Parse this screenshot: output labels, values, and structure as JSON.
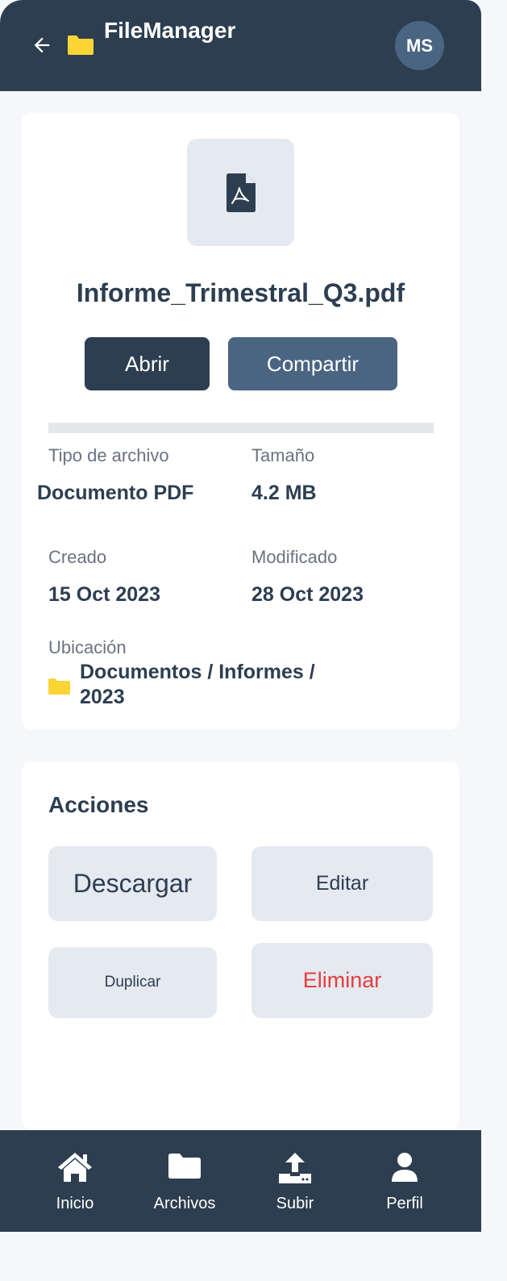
{
  "header": {
    "title": "FileManager",
    "avatar_initials": "MS"
  },
  "file": {
    "name": "Informe_Trimestral_Q3.pdf",
    "icon": "pdf-file-icon",
    "open_label": "Abrir",
    "share_label": "Compartir"
  },
  "details": {
    "type_label": "Tipo de archivo",
    "type_value": "Documento PDF",
    "size_label": "Tamaño",
    "size_value": "4.2 MB",
    "created_label": "Creado",
    "created_value": "15 Oct 2023",
    "modified_label": "Modificado",
    "modified_value": "28 Oct 2023",
    "location_label": "Ubicación",
    "location_value": "Documentos / Informes / 2023"
  },
  "actions": {
    "title": "Acciones",
    "download": "Descargar",
    "edit": "Editar",
    "duplicate": "Duplicar",
    "delete": "Eliminar"
  },
  "nav": {
    "items": [
      {
        "label": "Inicio",
        "icon": "home-icon"
      },
      {
        "label": "Archivos",
        "icon": "folder-icon"
      },
      {
        "label": "Subir",
        "icon": "upload-icon"
      },
      {
        "label": "Perfil",
        "icon": "user-icon"
      }
    ]
  },
  "colors": {
    "primary": "#2d3e50",
    "secondary": "#4a6582",
    "danger": "#e53e3e",
    "folder": "#fcd535"
  }
}
